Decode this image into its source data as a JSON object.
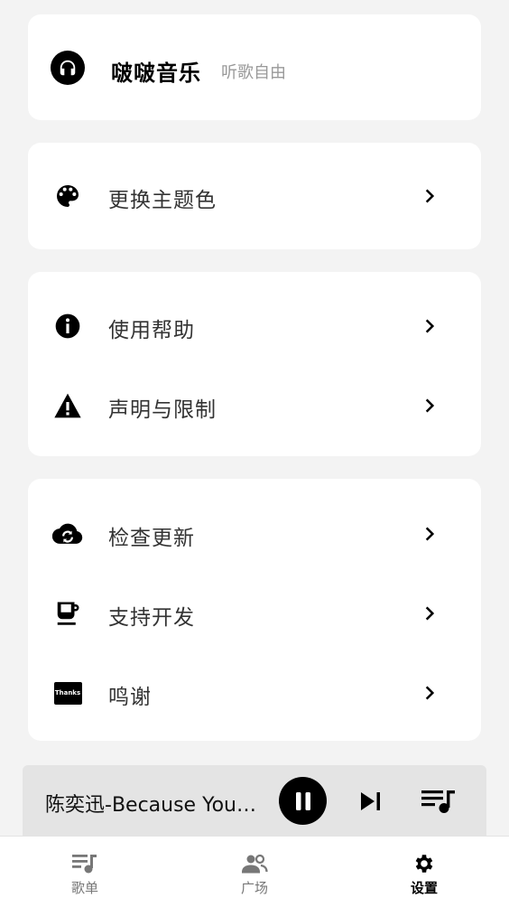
{
  "app": {
    "name": "啵啵音乐",
    "slogan": "听歌自由",
    "logo_icon": "headphones-icon"
  },
  "groups": [
    {
      "items": [
        {
          "label": "更换主题色",
          "icon": "palette-icon"
        }
      ]
    },
    {
      "items": [
        {
          "label": "使用帮助",
          "icon": "info-icon"
        },
        {
          "label": "声明与限制",
          "icon": "warning-icon"
        }
      ]
    },
    {
      "items": [
        {
          "label": "检查更新",
          "icon": "cloud-sync-icon"
        },
        {
          "label": "支持开发",
          "icon": "coffee-icon"
        },
        {
          "label": "鸣谢",
          "icon": "thanks-icon",
          "icon_text": "Thanks"
        }
      ]
    }
  ],
  "player": {
    "now_playing": "陈奕迅-Because You…",
    "state": "playing"
  },
  "bottom_nav": {
    "items": [
      {
        "label": "歌单",
        "icon": "playlist-icon",
        "active": false
      },
      {
        "label": "广场",
        "icon": "people-icon",
        "active": false
      },
      {
        "label": "设置",
        "icon": "gear-icon",
        "active": true
      }
    ]
  },
  "colors": {
    "background": "#f3f3f3",
    "card": "#ffffff",
    "accent": "#000000",
    "muted_text": "#999999",
    "player_bar": "#e4e4e4"
  }
}
